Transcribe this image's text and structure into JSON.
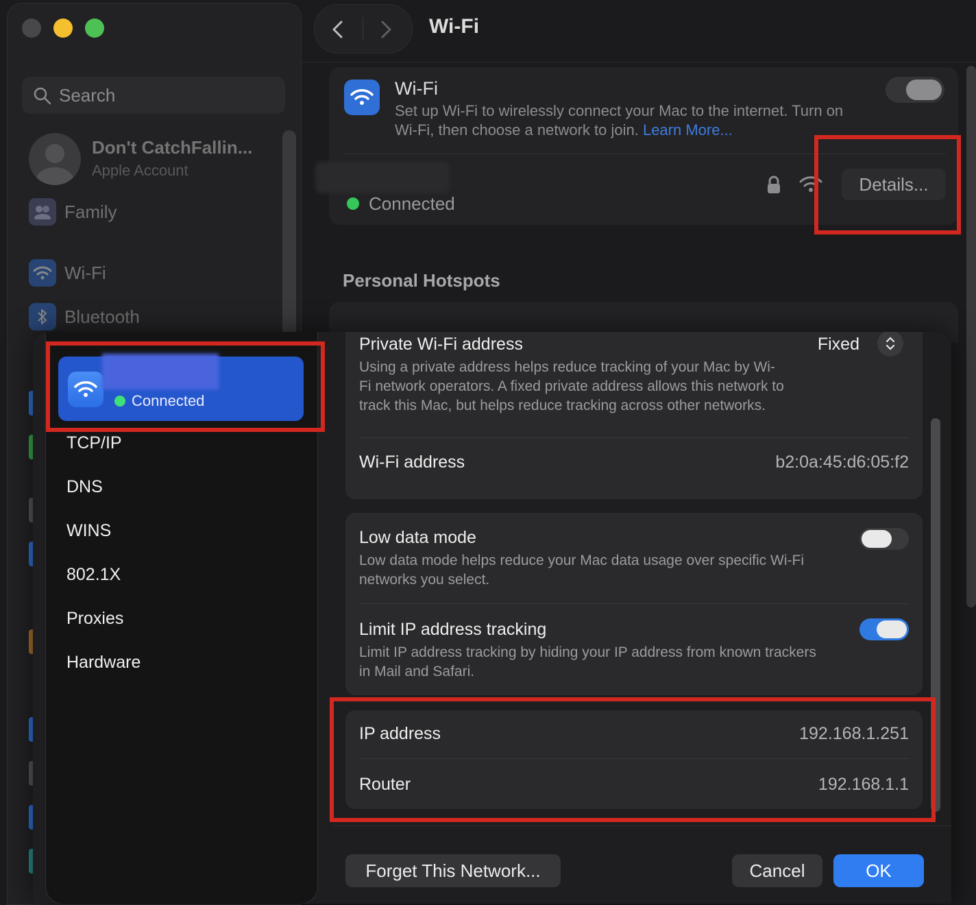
{
  "window": {
    "title": "Wi-Fi"
  },
  "sidebar": {
    "search_placeholder": "Search",
    "account": {
      "name": "Don't CatchFallin...",
      "subtitle": "Apple Account"
    },
    "items": [
      {
        "label": "Family",
        "icon": "family-icon"
      },
      {
        "label": "Wi-Fi",
        "icon": "wifi-icon"
      },
      {
        "label": "Bluetooth",
        "icon": "bluetooth-icon"
      }
    ]
  },
  "wifi_card": {
    "title": "Wi-Fi",
    "description": "Set up Wi-Fi to wirelessly connect your Mac to the internet. Turn on Wi-Fi, then choose a network to join.",
    "learn_more": "Learn More...",
    "network_status": "Connected",
    "details_button": "Details..."
  },
  "personal_hotspots": {
    "heading": "Personal Hotspots"
  },
  "sheet": {
    "network": {
      "status": "Connected"
    },
    "nav_items": [
      "TCP/IP",
      "DNS",
      "WINS",
      "802.1X",
      "Proxies",
      "Hardware"
    ],
    "private_address": {
      "title": "Private Wi-Fi address",
      "value": "Fixed",
      "description": "Using a private address helps reduce tracking of your Mac by Wi-Fi network operators. A fixed private address allows this network to track this Mac, but helps reduce tracking across other networks."
    },
    "wifi_address": {
      "label": "Wi-Fi address",
      "value": "b2:0a:45:d6:05:f2"
    },
    "low_data_mode": {
      "title": "Low data mode",
      "description": "Low data mode helps reduce your Mac data usage over specific Wi-Fi networks you select.",
      "enabled": false
    },
    "limit_ip": {
      "title": "Limit IP address tracking",
      "description": "Limit IP address tracking by hiding your IP address from known trackers in Mail and Safari.",
      "enabled": true
    },
    "ip_address": {
      "label": "IP address",
      "value": "192.168.1.251"
    },
    "router": {
      "label": "Router",
      "value": "192.168.1.1"
    },
    "buttons": {
      "forget": "Forget This Network...",
      "cancel": "Cancel",
      "ok": "OK"
    }
  },
  "colors": {
    "accent": "#2f7df0",
    "annotation": "#d3281f",
    "connected": "#35c759"
  }
}
